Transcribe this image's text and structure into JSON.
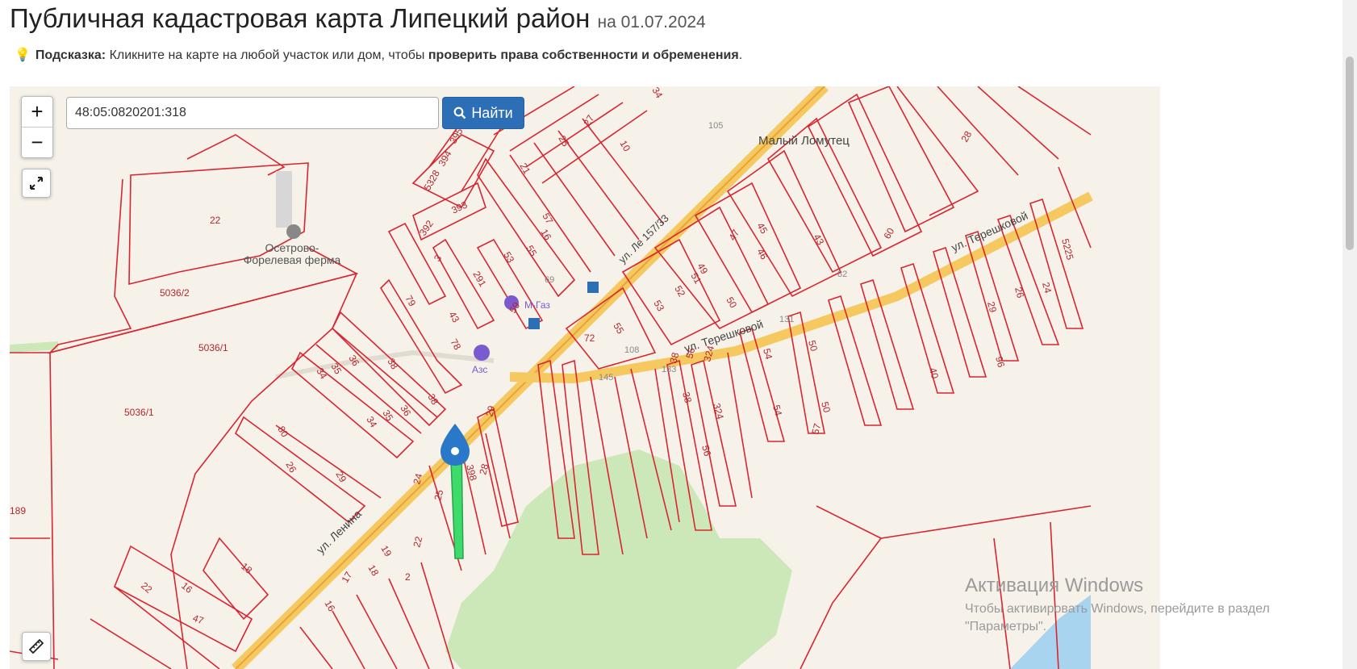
{
  "header": {
    "title": "Публичная кадастровая карта Липецкий район",
    "date_prefix": "на",
    "date": "01.07.2024"
  },
  "hint": {
    "label": "Подсказка:",
    "text": "Кликните на карте на любой участок или дом, чтобы",
    "bold_text": "проверить права собственности и обременения",
    "end": "."
  },
  "search": {
    "value": "48:05:0820201:318",
    "button_label": "Найти"
  },
  "controls": {
    "zoom_in": "+",
    "zoom_out": "−"
  },
  "map": {
    "places": {
      "farm_line1": "Осетрово-",
      "farm_line2": "Форелевая ферма",
      "village": "Малый Ломутец",
      "gas_station": "М-Газ",
      "azs": "Азс"
    },
    "streets": {
      "lenina": "ул. Ленина",
      "tereshkovoy1": "ул. Терешковой",
      "tereshkovoy2": "ул. Терешковой",
      "lenina_top": "ул. Ле 157/33"
    },
    "parcels": {
      "p22": "22",
      "p5036_2": "5036/2",
      "p5036_1a": "5036/1",
      "p5036_1b": "5036/1",
      "p189": "189",
      "p395": "395",
      "p394": "394",
      "p5328": "5328",
      "p393": "393",
      "p392": "392",
      "p3": "3",
      "p291": "291",
      "p53a": "53",
      "p55a": "55",
      "p21": "21",
      "p57a": "57",
      "p16a": "16",
      "p25a": "25",
      "p27": "27",
      "p10": "10",
      "p34a": "34",
      "p79": "79",
      "p43a": "43",
      "p78": "78",
      "p59": "59",
      "p36a": "36",
      "p35a": "35",
      "p34b": "34",
      "p38a": "38",
      "p38b": "38",
      "p36b": "36",
      "p35b": "35",
      "p34c": "34",
      "p80": "80",
      "p26a": "26",
      "p29a": "29",
      "p29b": "29",
      "p24a": "24",
      "p25b": "25",
      "p398": "398",
      "p28a": "28",
      "p22b": "22",
      "p19": "19",
      "p18a": "18",
      "p17": "17",
      "p16b": "16",
      "p2": "2",
      "p18b": "18",
      "p22c": "22",
      "p16c": "16",
      "p47a": "47",
      "p72": "72",
      "p55b": "55",
      "p53b": "53",
      "p52": "52",
      "p51": "51",
      "p49": "49",
      "p50a": "50",
      "p47b": "47",
      "p46": "46",
      "p45": "45",
      "p43b": "43",
      "p60": "60",
      "p28b": "28",
      "p5225": "5225",
      "p24b": "24",
      "p26b": "26",
      "p29c": "29",
      "p96": "96",
      "p40": "40",
      "p54a": "54",
      "p54b": "54",
      "p50b": "50",
      "p50c": "50",
      "p57b": "57",
      "p38c": "38",
      "p56a": "56",
      "p324a": "324",
      "p38d": "38",
      "p324b": "324",
      "p56b": "56",
      "n108": "108",
      "n145": "145",
      "n133": "133",
      "n69": "69",
      "n82": "82",
      "n131": "131",
      "n105": "105"
    }
  },
  "watermark": {
    "line1": "Активация Windows",
    "line2": "Чтобы активировать Windows, перейдите в раздел",
    "line3": "\"Параметры\"."
  },
  "colors": {
    "parcel_border": "#d9252f",
    "road": "#f5c860",
    "selected_parcel": "#3ddc6a",
    "forest": "#cde8b8",
    "water": "#a8d4f0",
    "button": "#2d6fb6",
    "marker": "#2a78c8"
  }
}
